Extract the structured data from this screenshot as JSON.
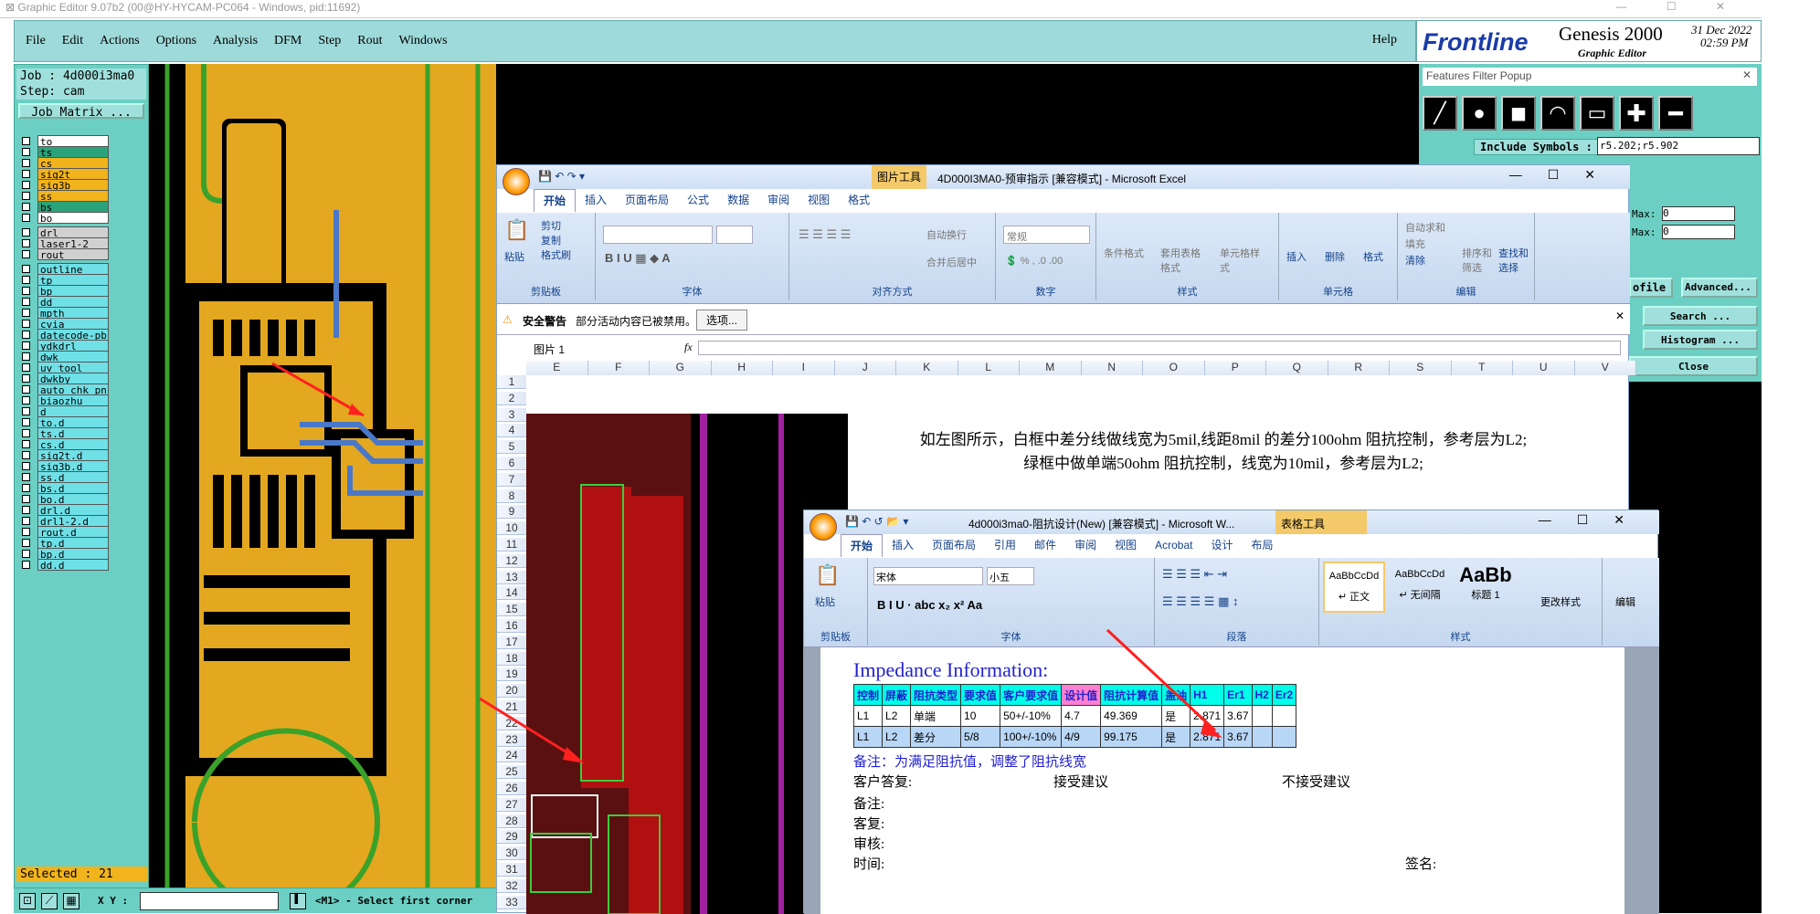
{
  "genesis": {
    "title": "Graphic Editor 9.07b2 (00@HY-HYCAM-PC064 - Windows, pid:11692)",
    "menu": [
      "File",
      "Edit",
      "Actions",
      "Options",
      "Analysis",
      "DFM",
      "Step",
      "Rout",
      "Windows"
    ],
    "help": "Help",
    "brand": "Frontline",
    "product": "Genesis 2000",
    "subtitle": "Graphic Editor",
    "date": "31 Dec 2022",
    "time": "02:59 PM",
    "job": "Job : 4d000i3ma0",
    "step": "Step: cam",
    "job_matrix": "Job Matrix ...",
    "layers": [
      {
        "name": "to",
        "color": "#ffffff"
      },
      {
        "name": "ts",
        "color": "#2aa37a"
      },
      {
        "name": "cs",
        "color": "#f2b41c"
      },
      {
        "name": "sig2t",
        "color": "#f2b41c"
      },
      {
        "name": "sig3b",
        "color": "#f2b41c"
      },
      {
        "name": "ss",
        "color": "#f2b41c"
      },
      {
        "name": "bs",
        "color": "#2aa37a"
      },
      {
        "name": "bo",
        "color": "#ffffff"
      }
    ],
    "layers2": [
      "drl",
      "laser1-2",
      "rout"
    ],
    "layers3": [
      "outline",
      "tp",
      "bp",
      "dd",
      "mpth",
      "cvia",
      "datecode-pb",
      "ydkdrl",
      "dwk",
      "uv_tool",
      "dwkby",
      "auto_chk_pn",
      "biaozhu",
      "d",
      "to.d",
      "ts.d",
      "cs.d",
      "sig2t.d",
      "sig3b.d",
      "ss.d",
      "bs.d",
      "bo.d",
      "drl.d",
      "drl1-2.d",
      "rout.d",
      "tp.d",
      "bp.d",
      "dd.d"
    ],
    "selected": "Selected : 21",
    "xy_label": "X Y :",
    "status": "<M1> - Select first corner"
  },
  "filter_popup": {
    "title": "Features Filter Popup",
    "include_symbols_label": "Include Symbols :",
    "include_symbols_value": "r5.202;r5.902",
    "max_label": "Max:",
    "max_value": "0",
    "profile_label": "ofile",
    "advanced": "Advanced...",
    "search": "Search ...",
    "histogram": "Histogram ...",
    "close": "Close"
  },
  "excel": {
    "tools_tab": "图片工具",
    "title": "4D000I3MA0-预审指示  [兼容模式] - Microsoft Excel",
    "tabs": [
      "开始",
      "插入",
      "页面布局",
      "公式",
      "数据",
      "审阅",
      "视图",
      "格式"
    ],
    "clipboard": {
      "paste": "粘贴",
      "cut": "剪切",
      "copy": "复制",
      "format_painter": "格式刷",
      "label": "剪贴板"
    },
    "font_label": "字体",
    "align": {
      "wrap": "自动换行",
      "merge": "合并后居中",
      "label": "对齐方式"
    },
    "number": {
      "format": "常规",
      "label": "数字"
    },
    "styles": {
      "conditional": "条件格式",
      "table": "套用表格格式",
      "cell": "单元格样式",
      "label": "样式"
    },
    "cells": {
      "insert": "插入",
      "delete": "删除",
      "format": "格式",
      "label": "单元格"
    },
    "edit": {
      "autosum": "自动求和",
      "fill": "填充",
      "clear": "清除",
      "sort": "排序和筛选",
      "find": "查找和选择",
      "label": "编辑"
    },
    "security_title": "安全警告",
    "security_msg": "部分活动内容已被禁用。",
    "options_btn": "选项...",
    "namebox": "图片 1",
    "fx": "fx",
    "columns": [
      "E",
      "F",
      "G",
      "H",
      "I",
      "J",
      "K",
      "L",
      "M",
      "N",
      "O",
      "P",
      "Q",
      "R",
      "S",
      "T",
      "U",
      "V"
    ],
    "rows": [
      "1",
      "2",
      "3",
      "4",
      "5",
      "6",
      "7",
      "8",
      "9",
      "10",
      "11",
      "12",
      "13",
      "14",
      "15",
      "16",
      "17",
      "18",
      "19",
      "20",
      "21",
      "22",
      "23",
      "24",
      "25",
      "26",
      "27",
      "28",
      "29",
      "30",
      "31",
      "32",
      "33"
    ],
    "note1": "如左图所示，白框中差分线做线宽为5mil,线距8mil 的差分100ohm 阻抗控制，参考层为L2;",
    "note2": "绿框中做单端50ohm 阻抗控制，线宽为10mil，参考层为L2;"
  },
  "word": {
    "title": "4d000i3ma0-阻抗设计(New) [兼容模式] - Microsoft W...",
    "tools_tab": "表格工具",
    "tabs": [
      "开始",
      "插入",
      "页面布局",
      "引用",
      "邮件",
      "审阅",
      "视图",
      "Acrobat",
      "设计",
      "布局"
    ],
    "paste": "粘贴",
    "clipboard_label": "剪贴板",
    "font_name": "宋体",
    "font_size": "小五",
    "font_label": "字体",
    "para_label": "段落",
    "styles": [
      {
        "sample": "AaBbCcDd",
        "name": "↵ 正文"
      },
      {
        "sample": "AaBbCcDd",
        "name": "↵ 无间隔"
      },
      {
        "sample": "AaBb",
        "name": "标题 1"
      }
    ],
    "change_styles": "更改样式",
    "styles_label": "样式",
    "edit": "编辑",
    "heading": "Impedance Information:",
    "table_headers": [
      "控制",
      "屏蔽",
      "阻抗类型",
      "要求值",
      "客户要求值",
      "设计值",
      "阻抗计算值",
      "盖油",
      "H1",
      "Er1",
      "H2",
      "Er2"
    ],
    "table_rows": [
      [
        "L1",
        "L2",
        "单端",
        "10",
        "50+/-10%",
        "4.7",
        "49.369",
        "是",
        "2.871",
        "3.67",
        "",
        ""
      ],
      [
        "L1",
        "L2",
        "差分",
        "5/8",
        "100+/-10%",
        "4/9",
        "99.175",
        "是",
        "2.871",
        "3.67",
        "",
        ""
      ]
    ],
    "remark": "备注：为满足阻抗值，调整了阻抗线宽",
    "reply_label": "客户答复:",
    "accept": "接受建议",
    "reject": "不接受建议",
    "note_label": "备注:",
    "recheck": "客复:",
    "review": "审核:",
    "time": "时间:",
    "sign": "签名:"
  }
}
